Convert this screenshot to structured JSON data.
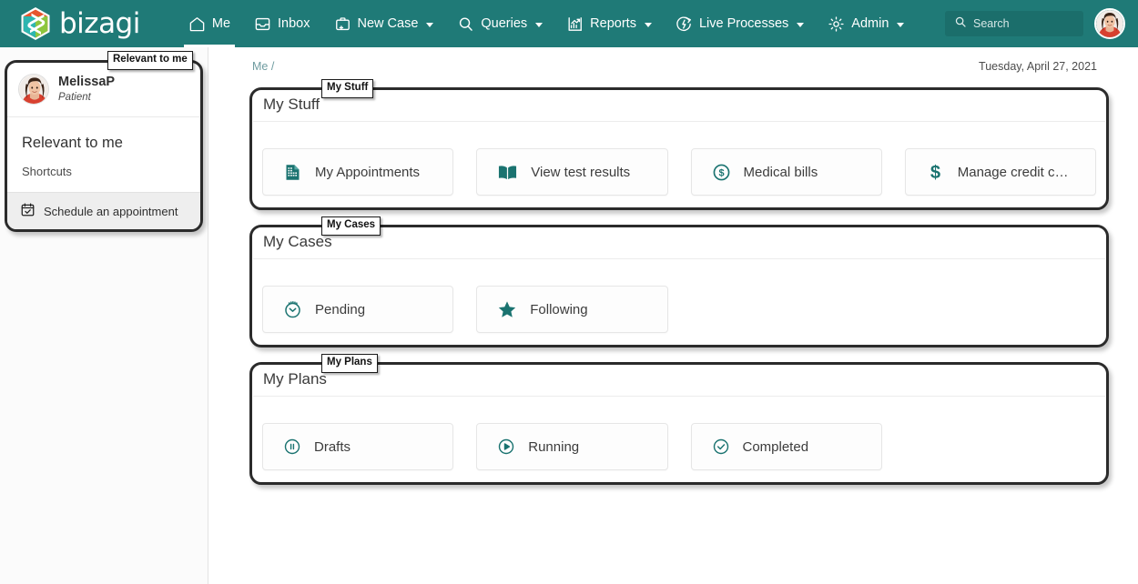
{
  "header": {
    "brand_name": "bizagi",
    "brand_logo": "bizagi-hexagon-logo",
    "nav": [
      {
        "label": "Me",
        "icon": "home-icon",
        "active": true,
        "caret": false
      },
      {
        "label": "Inbox",
        "icon": "inbox-icon",
        "active": false,
        "caret": false
      },
      {
        "label": "New Case",
        "icon": "new-case-icon",
        "active": false,
        "caret": true
      },
      {
        "label": "Queries",
        "icon": "search-icon",
        "active": false,
        "caret": true
      },
      {
        "label": "Reports",
        "icon": "reports-chart-icon",
        "active": false,
        "caret": true
      },
      {
        "label": "Live Processes",
        "icon": "live-processes-icon",
        "active": false,
        "caret": true
      },
      {
        "label": "Admin",
        "icon": "gear-icon",
        "active": false,
        "caret": true
      }
    ],
    "search": {
      "placeholder": "Search",
      "value": "",
      "icon": "search-icon"
    },
    "avatar": {
      "name": "user-avatar"
    },
    "colors": {
      "bar": "#1f7a77",
      "search_bg": "#1b6e6b",
      "accent": "#1a7370"
    }
  },
  "sidebar": {
    "annotation": "Relevant to me",
    "profile": {
      "name": "MelissaP",
      "role": "Patient",
      "avatar": "user-avatar"
    },
    "heading": "Relevant to me",
    "subheading": "Shortcuts",
    "shortcut": {
      "label": "Schedule an appointment",
      "icon": "calendar-check-icon"
    }
  },
  "main": {
    "breadcrumb": "Me /",
    "date": "Tuesday, April 27, 2021",
    "sections": [
      {
        "title": "My Stuff",
        "annotation": "My Stuff",
        "tiles": [
          {
            "label": "My Appointments",
            "icon": "document-report-icon"
          },
          {
            "label": "View test results",
            "icon": "open-book-icon"
          },
          {
            "label": "Medical bills",
            "icon": "dollar-circle-icon"
          },
          {
            "label": "Manage credit cards",
            "icon": "dollar-sign-icon"
          }
        ]
      },
      {
        "title": "My Cases",
        "annotation": "My Cases",
        "tiles": [
          {
            "label": "Pending",
            "icon": "clock-pending-icon"
          },
          {
            "label": "Following",
            "icon": "star-filled-icon"
          }
        ]
      },
      {
        "title": "My Plans",
        "annotation": "My Plans",
        "tiles": [
          {
            "label": "Drafts",
            "icon": "pause-circle-icon"
          },
          {
            "label": "Running",
            "icon": "play-circle-icon"
          },
          {
            "label": "Completed",
            "icon": "check-circle-icon"
          }
        ]
      }
    ]
  }
}
